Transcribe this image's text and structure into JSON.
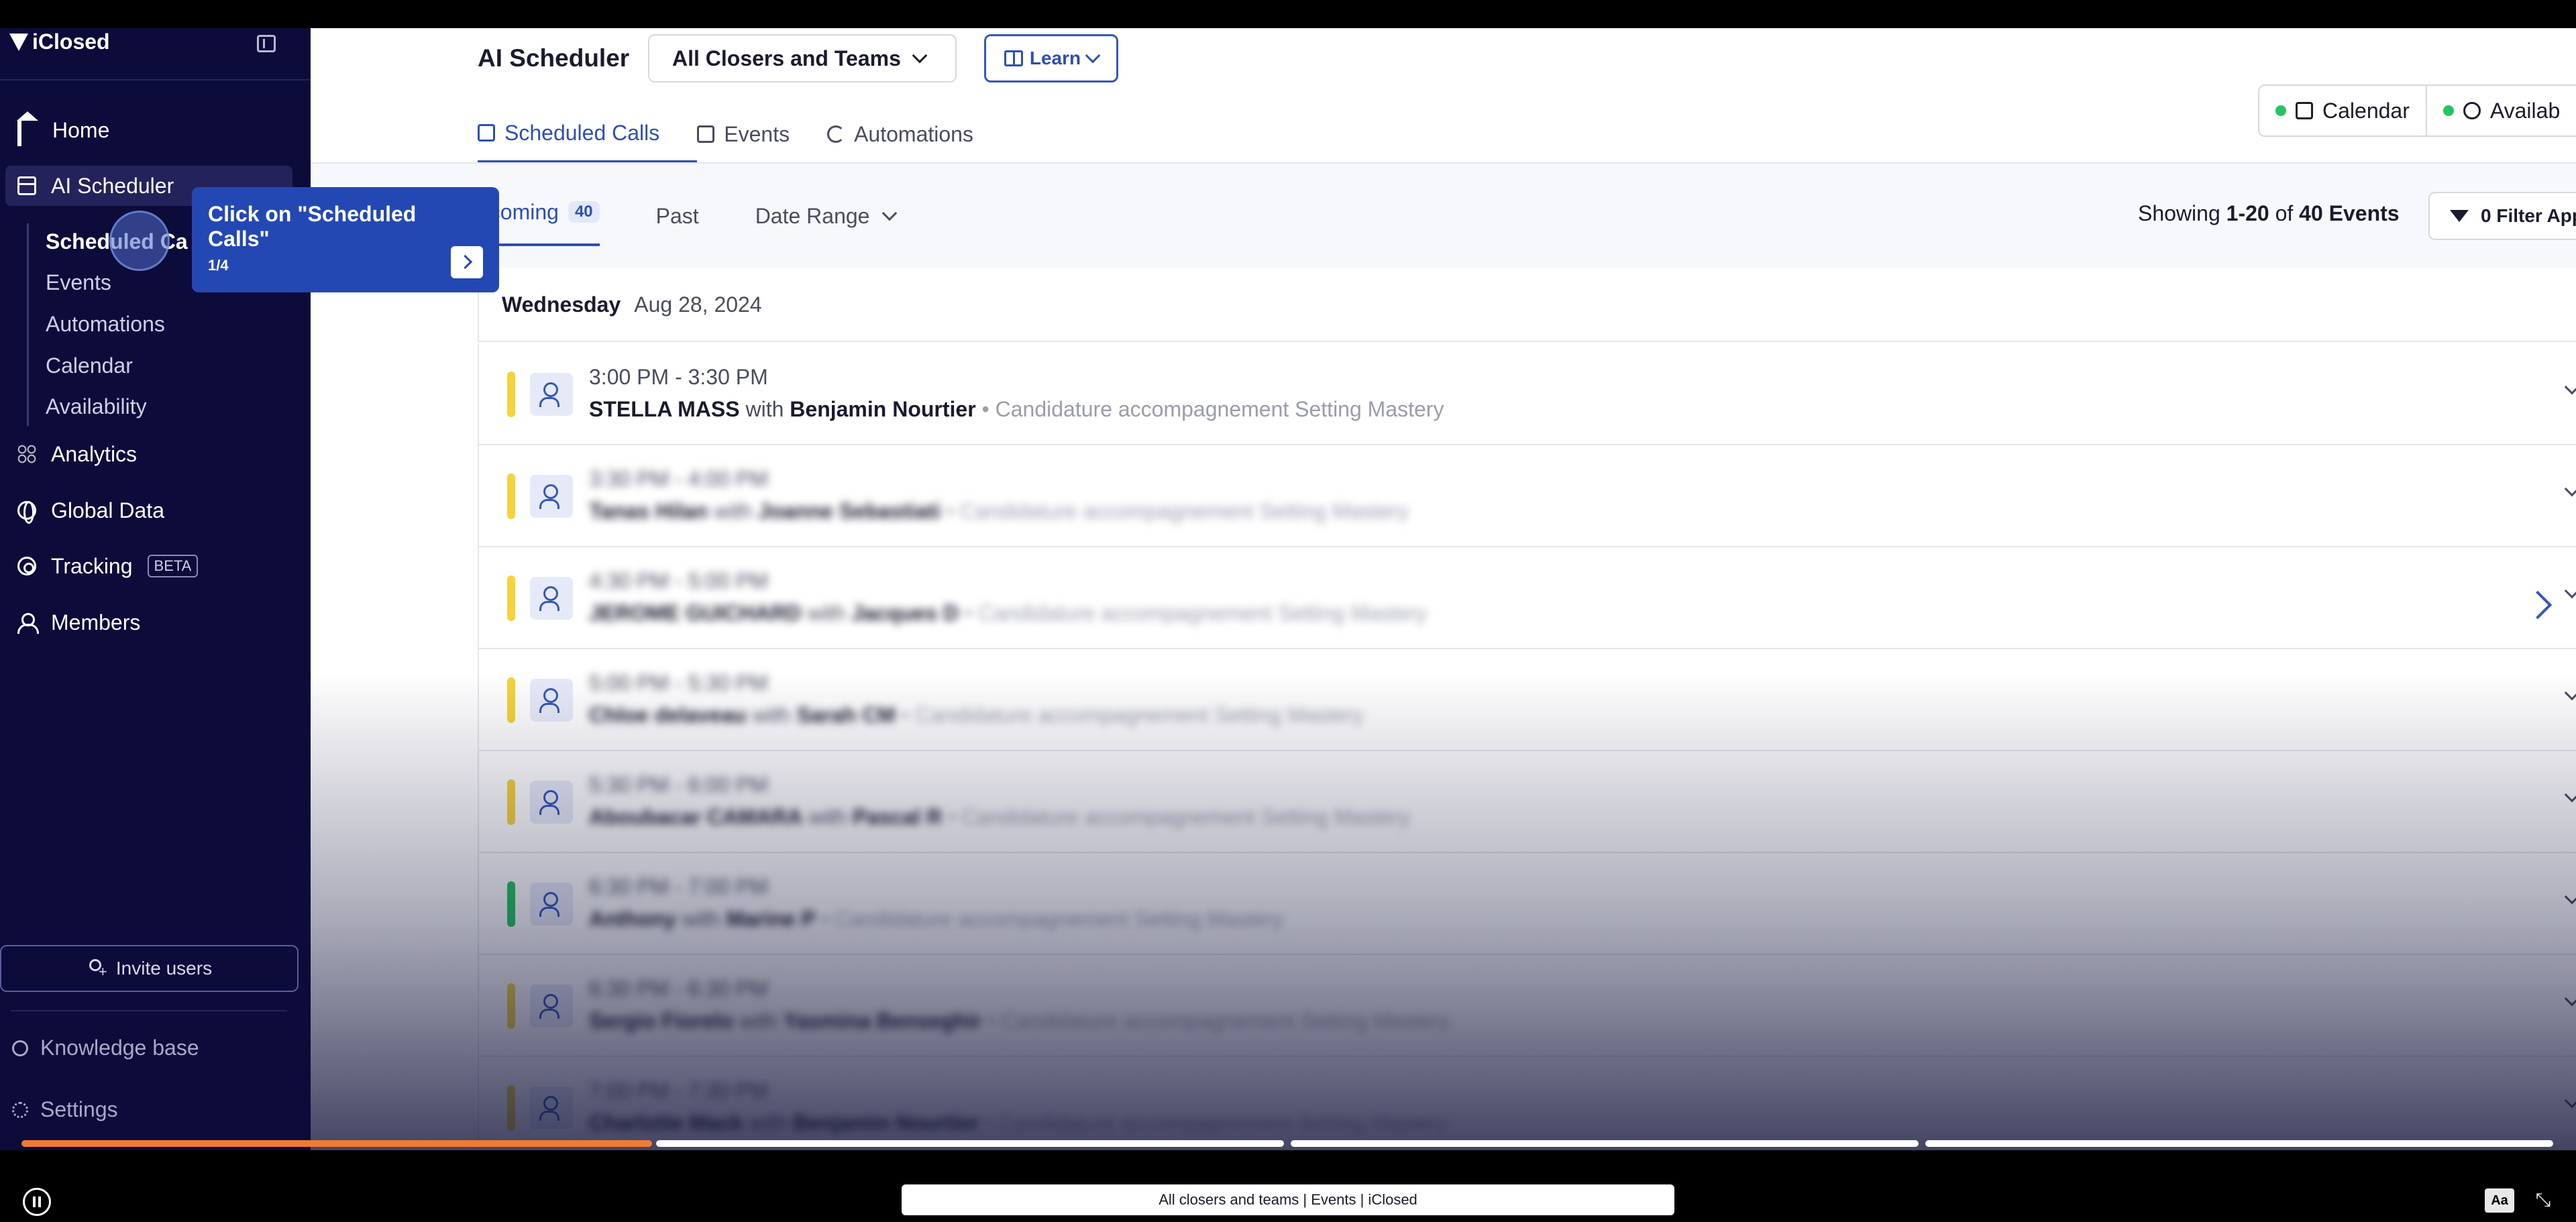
{
  "app": {
    "brand": "iClosed"
  },
  "sidebar": {
    "nav": [
      {
        "label": "Home",
        "icon": "home-icon"
      },
      {
        "label": "AI Scheduler",
        "icon": "calendar-icon"
      },
      {
        "label": "Analytics",
        "icon": "grid-icon"
      },
      {
        "label": "Global Data",
        "icon": "globe-icon"
      },
      {
        "label": "Tracking",
        "icon": "target-icon",
        "badge": "BETA"
      },
      {
        "label": "Members",
        "icon": "members-icon"
      }
    ],
    "sub_items": [
      "Scheduled Ca",
      "Events",
      "Automations",
      "Calendar",
      "Availability"
    ],
    "invite_label": "Invite users",
    "knowledge_base": "Knowledge base",
    "settings": "Settings"
  },
  "header": {
    "title": "AI Scheduler",
    "closers_select": "All Closers and Teams",
    "learn_label": "Learn",
    "tabs": [
      "Scheduled Calls",
      "Events",
      "Automations"
    ],
    "view_options": [
      "Calendar",
      "Availab"
    ]
  },
  "filters": {
    "upcoming_label": "pcoming",
    "upcoming_count": "40",
    "past_label": "Past",
    "date_range_label": "Date Range",
    "showing_prefix": "Showing",
    "showing_range": "1-20",
    "showing_of": "of",
    "showing_total": "40 Events",
    "filter_label": "0 Filter App"
  },
  "day": {
    "weekday": "Wednesday",
    "date": "Aug 28, 2024"
  },
  "rows": [
    {
      "time": "3:00 PM - 3:30 PM",
      "name": "STELLA MASS",
      "with": "with",
      "closer": "Benjamin Nourtier",
      "event": "• Candidature accompagnement Setting Mastery",
      "color": "#f5d33a"
    },
    {
      "time": "3:30 PM - 4:00 PM",
      "name": "Tanas Hilan",
      "with": "with",
      "closer": "Joanne Sebastiati",
      "event": "• Candidature accompagnement Setting Mastery",
      "color": "#f5d33a"
    },
    {
      "time": "4:30 PM - 5:00 PM",
      "name": "JEROME GUICHARD",
      "with": "with",
      "closer": "Jacques D",
      "event": "• Candidature accompagnement Setting Mastery",
      "color": "#f5d33a"
    },
    {
      "time": "5:00 PM - 5:30 PM",
      "name": "Chloe delaveau",
      "with": "with",
      "closer": "Sarah CM",
      "event": "• Candidature accompagnement Setting Mastery",
      "color": "#f5d33a"
    },
    {
      "time": "5:30 PM - 6:00 PM",
      "name": "Aboubacar CAMARA",
      "with": "with",
      "closer": "Pascal R",
      "event": "• Candidature accompagnement Setting Mastery",
      "color": "#f5d33a"
    },
    {
      "time": "6:30 PM - 7:00 PM",
      "name": "Anthony",
      "with": "with",
      "closer": "Marine P",
      "event": "• Candidature accompagnement Setting Mastery",
      "color": "#22c55e"
    },
    {
      "time": "6:30 PM - 6:30 PM",
      "name": "Sergio Fiorelo",
      "with": "with",
      "closer": "Yasmina Benseghir",
      "event": "• Candidature accompagnement Setting Mastery",
      "color": "#f5d33a"
    },
    {
      "time": "7:00 PM - 7:30 PM",
      "name": "Charlotte Mack",
      "with": "with",
      "closer": "Benjamin Nourtier",
      "event": "• Candidature accompagnement Setting Mastery",
      "color": "#f5d33a"
    }
  ],
  "tooltip": {
    "title": "Click on \"Scheduled Calls\"",
    "step": "1/4"
  },
  "player": {
    "caption": "All closers and teams | Events | iClosed",
    "aa_label": "Aa",
    "progress_done_fraction": 0.25
  }
}
